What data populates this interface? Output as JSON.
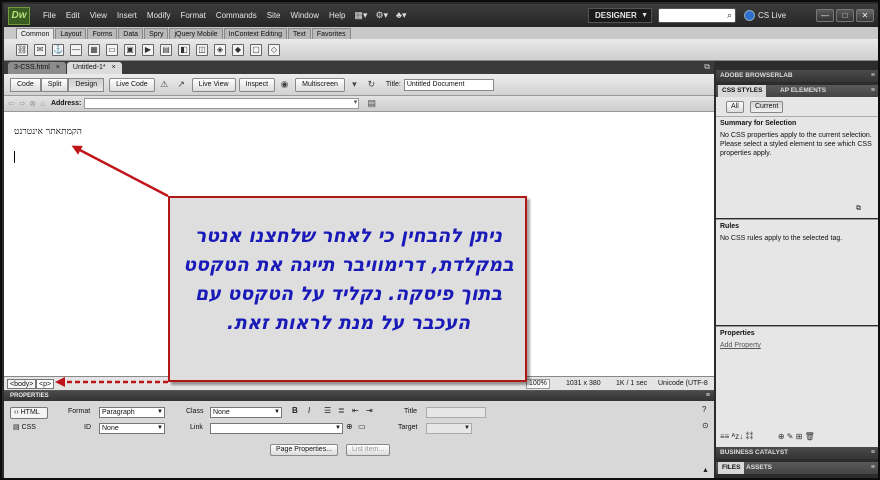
{
  "app": {
    "logo": "Dw",
    "menu": [
      "File",
      "Edit",
      "View",
      "Insert",
      "Modify",
      "Format",
      "Commands",
      "Site",
      "Window",
      "Help"
    ],
    "workspace": "DESIGNER",
    "cs_live": "CS Live"
  },
  "insert_panel": {
    "tabs": [
      "Common",
      "Layout",
      "Forms",
      "Data",
      "Spry",
      "jQuery Mobile",
      "InContext Editing",
      "Text",
      "Favorites"
    ],
    "active_tab": "Common"
  },
  "documents": {
    "tabs": [
      {
        "label": "3-CSS.html",
        "close": "×"
      },
      {
        "label": "Untitled-1*",
        "close": "×"
      }
    ]
  },
  "doc_toolbar": {
    "code": "Code",
    "split": "Split",
    "design": "Design",
    "live_code": "Live Code",
    "live_view": "Live View",
    "inspect": "Inspect",
    "multiscreen": "Multiscreen",
    "title_label": "Title:",
    "title_value": "Untitled Document"
  },
  "address_bar": {
    "label": "Address:",
    "value": ""
  },
  "document": {
    "text": "הקמתאתר אינטרנט"
  },
  "annotation": {
    "text": "ניתן להבחין כי לאחר שלחצנו אנטר במקלדת, דרימוויבר תייגה את הטקסט בתוך פיסקה. נקליד על הטקסט עם העכבר על מנת לראות זאת.",
    "colors": {
      "border": "#b01818",
      "text": "#1a1ab8",
      "arrow": "#c0141a"
    }
  },
  "status_bar": {
    "tag_body": "<body>",
    "tag_p": "<p>",
    "zoom": "100%",
    "window_size": "1031 x 380",
    "download": "1K / 1 sec",
    "encoding": "Unicode (UTF-8"
  },
  "properties": {
    "header": "PROPERTIES",
    "html_mode": "HTML",
    "css_mode": "CSS",
    "format_label": "Format",
    "format_value": "Paragraph",
    "id_label": "ID",
    "id_value": "None",
    "class_label": "Class",
    "class_value": "None",
    "link_label": "Link",
    "link_value": "",
    "bold": "B",
    "italic": "I",
    "title_label": "Title",
    "target_label": "Target",
    "page_properties": "Page Properties...",
    "list_item": "List Item..."
  },
  "right_panel": {
    "browserlab": "ADOBE BROWSERLAB",
    "css_styles_tab": "CSS STYLES",
    "ap_elements_tab": "AP ELEMENTS",
    "all": "All",
    "current": "Current",
    "summary_title": "Summary for Selection",
    "summary_text": "No CSS properties apply to the current selection.  Please select a styled element to see which CSS properties apply.",
    "rules_title": "Rules",
    "rules_text": "No CSS rules apply to the selected tag.",
    "properties_title": "Properties",
    "add_property": "Add Property",
    "business_catalyst": "BUSINESS CATALYST",
    "files_tab": "FILES",
    "assets_tab": "ASSETS"
  }
}
